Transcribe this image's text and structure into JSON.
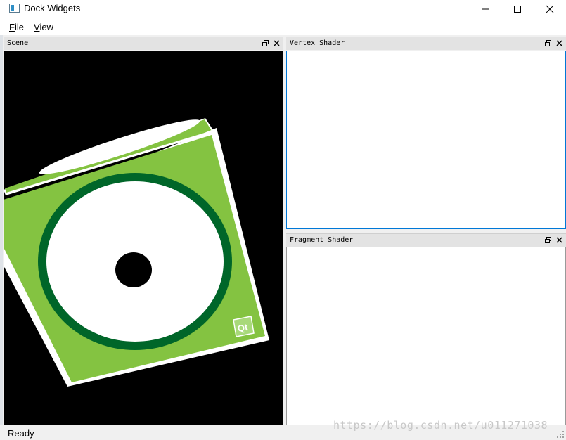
{
  "window": {
    "title": "Dock Widgets",
    "icon": "app-window-icon",
    "controls": [
      "minimize-icon",
      "maximize-icon",
      "close-icon"
    ]
  },
  "menubar": {
    "file": {
      "mnemonic": "F",
      "rest": "ile"
    },
    "view": {
      "mnemonic": "V",
      "rest": "iew"
    }
  },
  "docks": {
    "scene": {
      "title": "Scene"
    },
    "vertex": {
      "title": "Vertex Shader"
    },
    "fragment": {
      "title": "Fragment Shader"
    }
  },
  "scene": {
    "background": "#000000",
    "cube_face_color": "#84c341",
    "ring_color": "#006629",
    "logo_text": "Qt"
  },
  "status": {
    "text": "Ready"
  },
  "watermark": "https://blog.csdn.net/u011271038",
  "colors": {
    "focus_border": "#0078d7",
    "dock_title_bg": "#e3e3e3"
  }
}
